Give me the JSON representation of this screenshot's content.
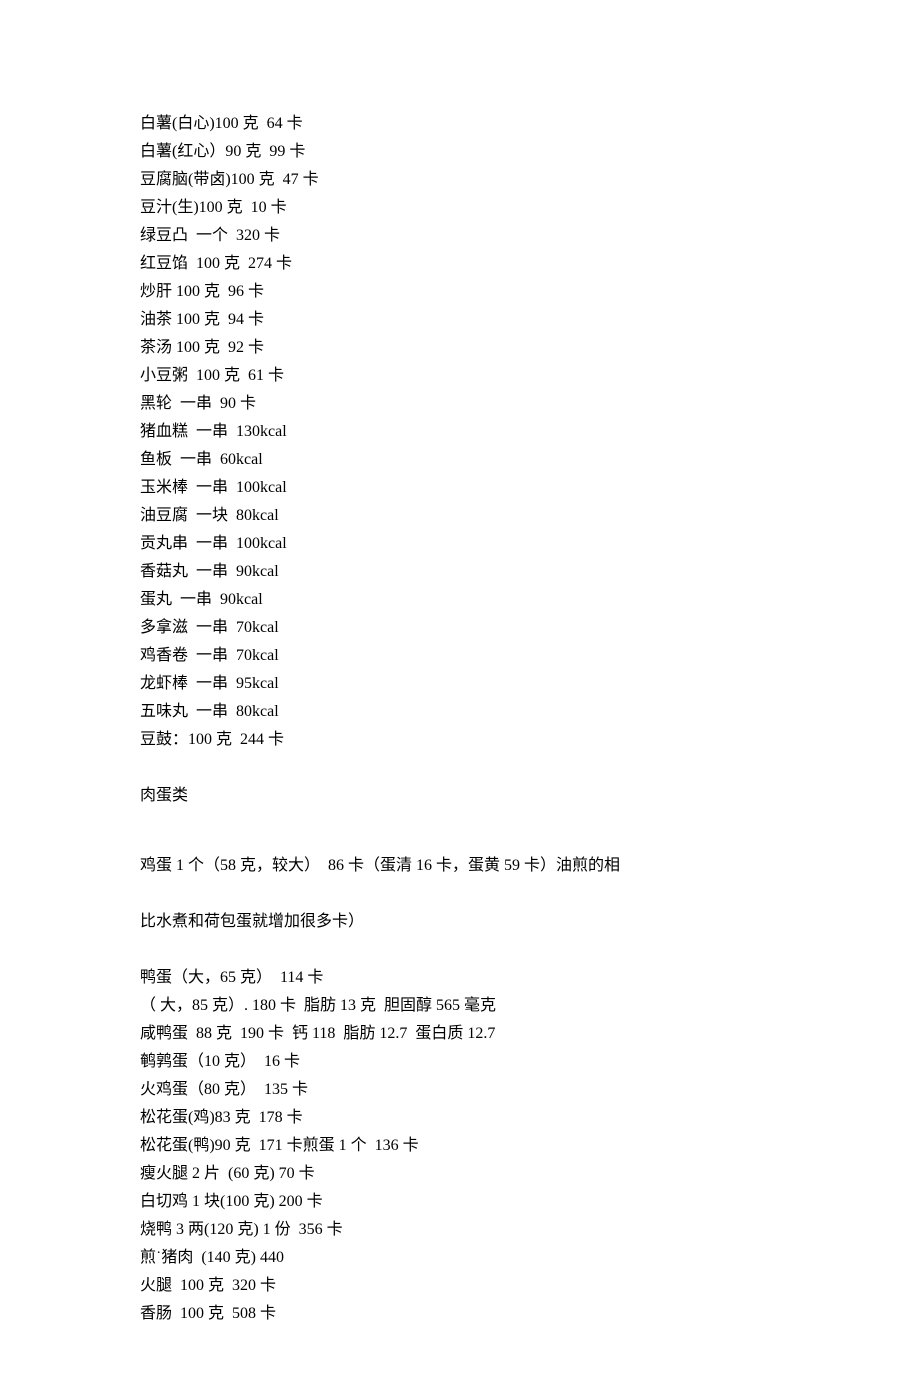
{
  "lines1": [
    "白薯(白心)100 克  64 卡",
    "白薯(红心）90 克  99 卡",
    "豆腐脑(带卤)100 克  47 卡",
    "豆汁(生)100 克  10 卡",
    "绿豆凸  一个  320 卡",
    "红豆馅  100 克  274 卡",
    "炒肝 100 克  96 卡",
    "油茶 100 克  94 卡",
    "茶汤 100 克  92 卡",
    "小豆粥  100 克  61 卡",
    "黑轮  一串  90 卡",
    "猪血糕  一串  130kcal",
    "鱼板  一串  60kcal",
    "玉米棒  一串  100kcal",
    "油豆腐  一块  80kcal",
    "贡丸串  一串  100kcal",
    "香菇丸  一串  90kcal",
    "蛋丸  一串  90kcal",
    "多拿滋  一串  70kcal",
    "鸡香卷  一串  70kcal",
    "龙虾棒  一串  95kcal",
    "五味丸  一串  80kcal",
    "豆鼓：100 克  244 卡"
  ],
  "heading1": "肉蛋类",
  "lines2": [
    "鸡蛋 1 个（58 克，较大）  86 卡（蛋清 16 卡，蛋黄 59 卡）油煎的相"
  ],
  "lines3": [
    "比水煮和荷包蛋就增加很多卡）"
  ],
  "lines4": [
    "鸭蛋（大，65 克）  114 卡",
    "（ 大，85 克）. 180 卡  脂肪 13 克  胆固醇 565 毫克",
    "咸鸭蛋  88 克  190 卡  钙 118  脂肪 12.7  蛋白质 12.7",
    "鹌鹑蛋（10 克）  16 卡",
    "火鸡蛋（80 克）  135 卡",
    "松花蛋(鸡)83 克  178 卡",
    "松花蛋(鸭)90 克  171 卡煎蛋 1 个  136 卡",
    "瘦火腿 2 片  (60 克) 70 卡",
    "白切鸡 1 块(100 克) 200 卡",
    "烧鸭 3 两(120 克) 1 份  356 卡",
    "煎˙猪肉  (140 克) 440",
    "火腿  100 克  320 卡",
    "香肠  100 克  508 卡"
  ]
}
